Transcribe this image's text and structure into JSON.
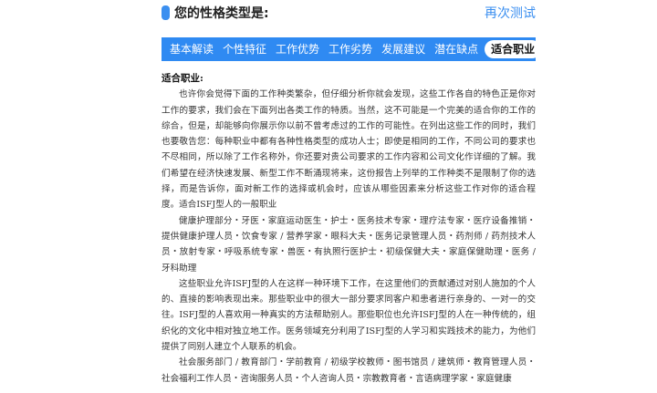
{
  "header": {
    "title": "您的性格类型是:",
    "retest_label": "再次测试"
  },
  "tabs": [
    {
      "label": "基本解读",
      "active": false
    },
    {
      "label": "个性特征",
      "active": false
    },
    {
      "label": "工作优势",
      "active": false
    },
    {
      "label": "工作劣势",
      "active": false
    },
    {
      "label": "发展建议",
      "active": false
    },
    {
      "label": "潜在缺点",
      "active": false
    },
    {
      "label": "适合职业",
      "active": true
    }
  ],
  "content": {
    "section_title": "适合职业:",
    "paragraphs": [
      "也许你会觉得下面的工作种类繁杂，但仔细分析你就会发现，这些工作各自的特色正是你对工作的要求，我们会在下面列出各类工作的特质。当然，这不可能是一个完美的适合你的工作的综合，但是，却能够向你展示你以前不曾考虑过的工作的可能性。在列出这些工作的同时，我们也要敬告您：每种职业中都有各种性格类型的成功人士；即使是相同的工作，不同公司的要求也不尽相同，所以除了工作名称外，你还要对贵公司要求的工作内容和公司文化作详细的了解。我们希望在经济快速发展、新型工作不断涌现将来，这份报告上列举的工作种类不是限制了你的选择，而是告诉你，面对新工作的选择或机会时，应该从哪些因素来分析这些工作对你的适合程度。适合ISFJ型人的一般职业",
      "健康护理部分・牙医・家庭运动医生・护士・医务技术专家・理疗法专家・医疗设备推销・提供健康护理人员・饮食专家 / 营养学家・眼科大夫・医务记录管理人员・药剂师 / 药剂技术人员・放射专家・呼吸系统专家・兽医・有执照行医护士・初级保健大夫・家庭保健助理・医务 / 牙科助理",
      "这些职业允许ISFJ型的人在这样一种环境下工作，在这里他们的贡献通过对别人施加的个人的、直接的影响表现出来。那些职业中的很大一部分要求同客户和患者进行亲身的、一对一的交往。ISFJ型的人喜欢用一种真实的方法帮助别人。那些职位也允许ISFJ型的人在一种传统的，组织化的文化中相对独立地工作。医务领域充分利用了ISFJ型的人学习和实践技术的能力，为他们提供了同别人建立个人联系的机会。",
      "社会服务部门 / 教育部门・学前教育 / 初级学校教师・图书馆员 / 建筑师・教育管理人员・社会福利工作人员・咨询服务人员・个人咨询人员・宗教教育者・言语病理学家・家庭健康"
    ]
  }
}
